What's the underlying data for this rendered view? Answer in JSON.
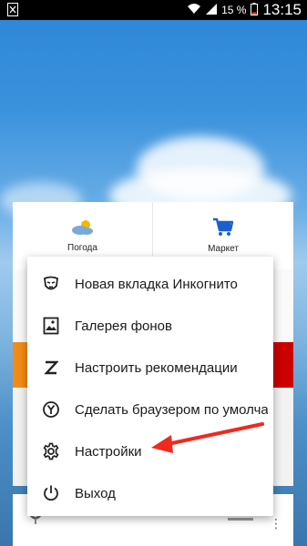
{
  "status_bar": {
    "battery_percent": "15 %",
    "time": "13:15"
  },
  "tiles": {
    "weather_label": "Погода",
    "market_label": "Маркет"
  },
  "menu": {
    "items": [
      {
        "label": "Новая вкладка Инкогнито",
        "icon": "incognito-mask-icon"
      },
      {
        "label": "Галерея фонов",
        "icon": "image-gallery-icon"
      },
      {
        "label": "Настроить рекомендации",
        "icon": "zen-z-icon"
      },
      {
        "label": "Сделать браузером по умолчанию",
        "icon": "yandex-y-icon"
      },
      {
        "label": "Настройки",
        "icon": "gear-icon"
      },
      {
        "label": "Выход",
        "icon": "power-icon"
      }
    ]
  },
  "annotation": {
    "arrow_color": "#ee2a1e"
  }
}
